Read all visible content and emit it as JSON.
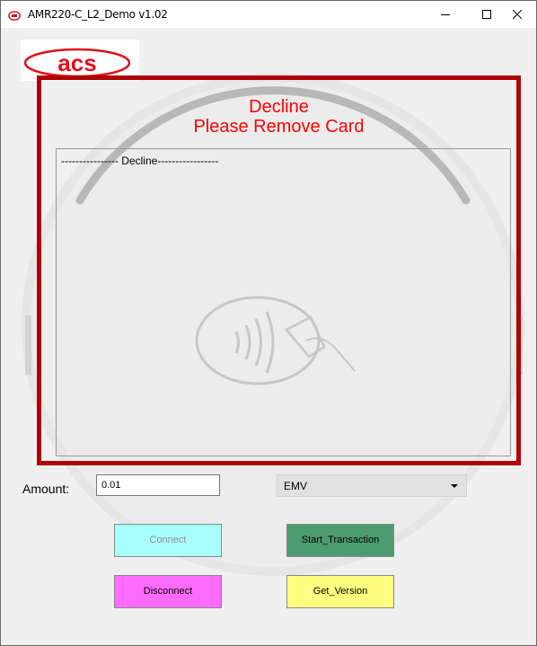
{
  "window": {
    "title": "AMR220-C_L2_Demo v1.02",
    "controls": {
      "minimize": "minimize-icon",
      "maximize": "maximize-icon",
      "close": "close-icon"
    }
  },
  "logo": {
    "text": "acs",
    "color": "#e0101c"
  },
  "status": {
    "line1": "Decline",
    "line2": "Please Remove Card",
    "color": "#ff0000",
    "frame_color": "#b00000"
  },
  "log": {
    "lines": [
      "---------------- Decline-----------------"
    ]
  },
  "form": {
    "amount_label": "Amount:",
    "amount_value": "0.01",
    "mode_selected": "EMV"
  },
  "buttons": {
    "connect": "Connect",
    "start_transaction": "Start_Transaction",
    "disconnect": "Disconnect",
    "get_version": "Get_Version"
  },
  "colors": {
    "connect_bg": "#a8fdfd",
    "start_bg": "#4d9b71",
    "disconnect_bg": "#ff6bff",
    "version_bg": "#ffff80"
  }
}
